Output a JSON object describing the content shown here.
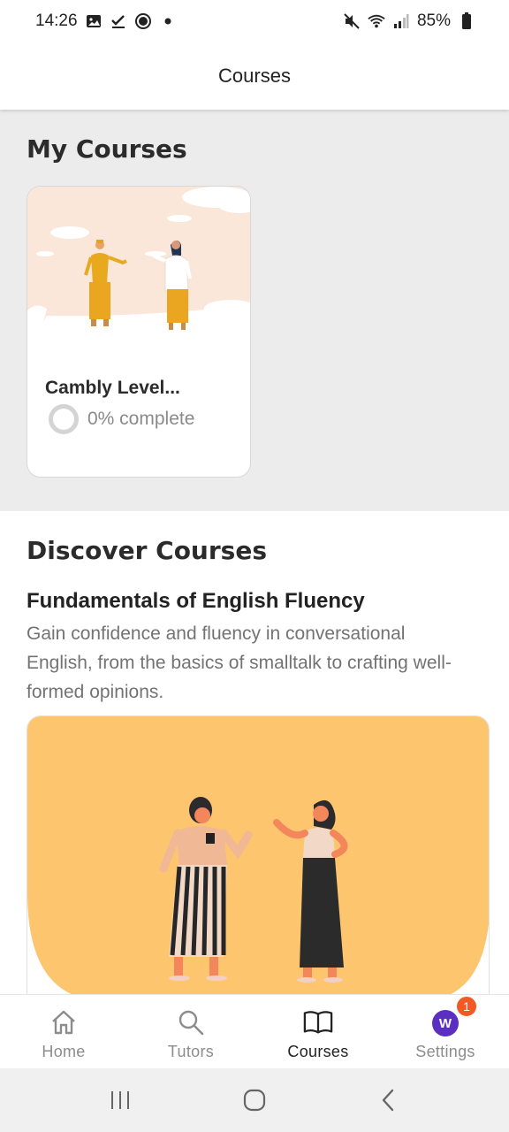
{
  "status_bar": {
    "time": "14:26",
    "battery": "85%",
    "left_icons": [
      "gallery-icon",
      "check-icon",
      "sync-icon",
      "dot-icon"
    ],
    "right_icons": [
      "mute-icon",
      "wifi-icon",
      "signal-icon",
      "battery-icon"
    ]
  },
  "app_bar": {
    "title": "Courses"
  },
  "my_courses": {
    "title": "My Courses",
    "cards": [
      {
        "name": "Cambly Level...",
        "progress_label": "0% complete",
        "progress": 0
      }
    ]
  },
  "discover": {
    "title": "Discover Courses",
    "course_title": "Fundamentals of English Fluency",
    "course_description": "Gain confidence and fluency in conversational English, from the basics of smalltalk to crafting well-formed opinions."
  },
  "bottom_nav": {
    "items": [
      {
        "label": "Home",
        "icon": "home-icon",
        "active": false
      },
      {
        "label": "Tutors",
        "icon": "search-icon",
        "active": false
      },
      {
        "label": "Courses",
        "icon": "book-icon",
        "active": true
      },
      {
        "label": "Settings",
        "icon": "avatar",
        "active": false
      }
    ],
    "avatar_initial": "W",
    "badge_count": "1"
  },
  "system_nav": {
    "buttons": [
      "recents-icon",
      "home-button-icon",
      "back-icon"
    ]
  },
  "colors": {
    "section_bg": "#ececec",
    "banner_bg": "#fdc66e",
    "card_illu_bg": "#fbe6da",
    "avatar": "#5a2fc2",
    "badge": "#f15a24"
  }
}
